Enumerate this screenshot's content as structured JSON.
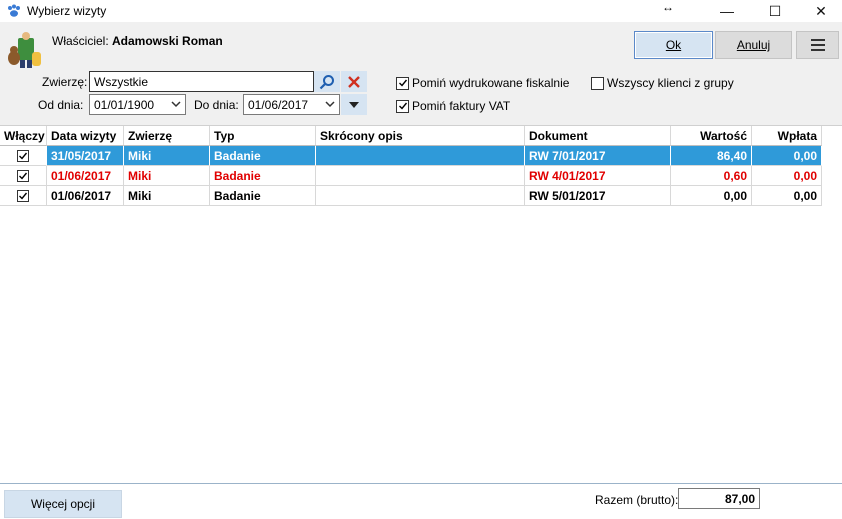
{
  "window": {
    "title": "Wybierz wizyty",
    "controls": {
      "minimize": "—",
      "maximize": "☐",
      "close": "✕"
    }
  },
  "header": {
    "owner_label": "Właściciel:",
    "owner_name": "Adamowski Roman",
    "buttons": {
      "ok": "Ok",
      "cancel": "Anuluj",
      "menu_icon": "hamburger-icon"
    }
  },
  "filters": {
    "animal_label": "Zwierzę:",
    "animal_value": "Wszystkie",
    "from_label": "Od dnia:",
    "from_value": "01/01/1900",
    "to_label": "Do dnia:",
    "to_value": "01/06/2017",
    "options": [
      {
        "label": "Pomiń wydrukowane fiskalnie",
        "checked": true
      },
      {
        "label": "Pomiń faktury VAT",
        "checked": true
      },
      {
        "label": "Wszyscy klienci z grupy",
        "checked": false
      }
    ]
  },
  "grid": {
    "columns": [
      "Włączy",
      "Data wizyty",
      "Zwierzę",
      "Typ",
      "Skrócony opis",
      "Dokument",
      "Wartość",
      "Wpłata"
    ],
    "rows": [
      {
        "checked": true,
        "date": "31/05/2017",
        "animal": "Miki",
        "type": "Badanie",
        "desc": "",
        "doc": "RW 7/01/2017",
        "value": "86,40",
        "paid": "0,00",
        "state": "selected"
      },
      {
        "checked": true,
        "date": "01/06/2017",
        "animal": "Miki",
        "type": "Badanie",
        "desc": "",
        "doc": "RW 4/01/2017",
        "value": "0,60",
        "paid": "0,00",
        "state": "red"
      },
      {
        "checked": true,
        "date": "01/06/2017",
        "animal": "Miki",
        "type": "Badanie",
        "desc": "",
        "doc": "RW 5/01/2017",
        "value": "0,00",
        "paid": "0,00",
        "state": "normal"
      }
    ]
  },
  "footer": {
    "more_options": "Więcej opcji",
    "total_label": "Razem (brutto):",
    "total_value": "87,00"
  },
  "colors": {
    "selection": "#2f9ad9",
    "warning_text": "#e00000",
    "primary_button": "#d6e4f2"
  }
}
